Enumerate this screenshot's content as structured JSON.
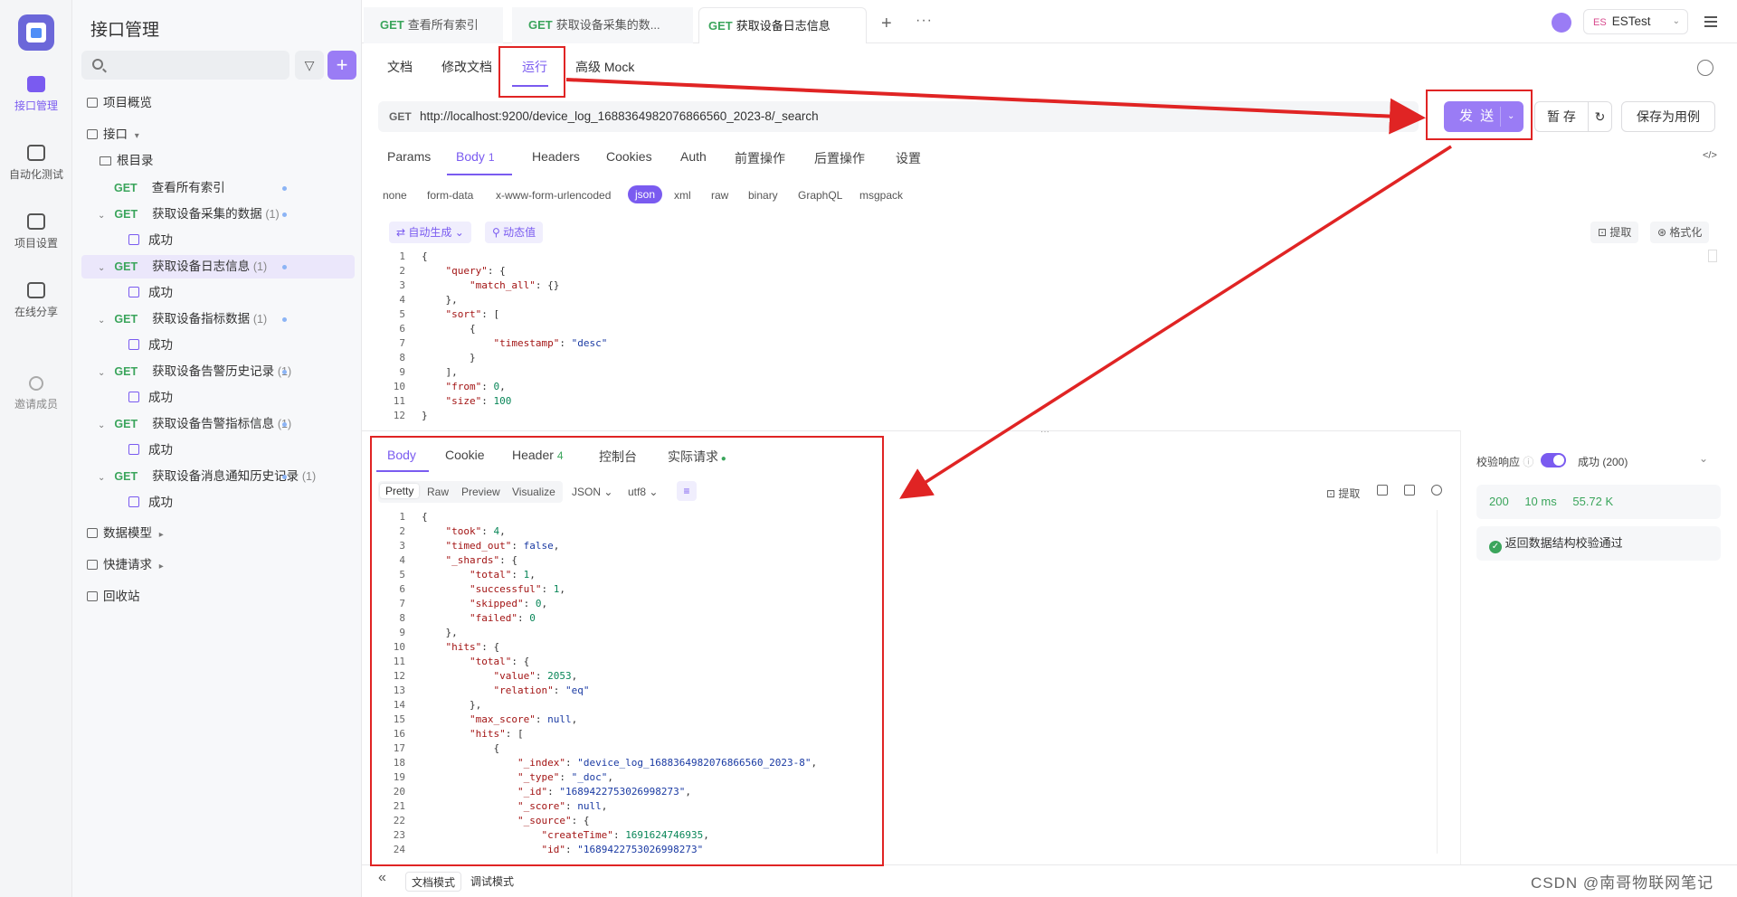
{
  "rail": {
    "items": [
      {
        "label": "接口管理"
      },
      {
        "label": "自动化测试"
      },
      {
        "label": "项目设置"
      },
      {
        "label": "在线分享"
      },
      {
        "label": "邀请成员"
      }
    ]
  },
  "tree": {
    "title": "接口管理",
    "overview": "项目概览",
    "interfaces": "接口",
    "root": "根目录",
    "items": [
      {
        "method": "GET",
        "name": "查看所有索引",
        "count": ""
      },
      {
        "method": "GET",
        "name": "获取设备采集的数据",
        "count": "(1)"
      },
      {
        "method": "GET",
        "name": "获取设备日志信息",
        "count": "(1)"
      },
      {
        "method": "GET",
        "name": "获取设备指标数据",
        "count": "(1)"
      },
      {
        "method": "GET",
        "name": "获取设备告警历史记录",
        "count": "(1)"
      },
      {
        "method": "GET",
        "name": "获取设备告警指标信息",
        "count": "(1)"
      },
      {
        "method": "GET",
        "name": "获取设备消息通知历史记录",
        "count": "(1)"
      }
    ],
    "success": "成功",
    "data_model": "数据模型",
    "quick_request": "快捷请求",
    "recycle": "回收站"
  },
  "tabs": [
    {
      "method": "GET",
      "label": "查看所有索引"
    },
    {
      "method": "GET",
      "label": "获取设备采集的数..."
    },
    {
      "method": "GET",
      "label": "获取设备日志信息"
    }
  ],
  "env": {
    "tag": "ES",
    "name": "ESTest"
  },
  "subtabs": {
    "doc": "文档",
    "edit": "修改文档",
    "run": "运行",
    "mock": "高级 Mock"
  },
  "request": {
    "method": "GET",
    "url": "http://localhost:9200/device_log_1688364982076866560_2023-8/_search",
    "send": "发 送",
    "save": "暂 存",
    "save_case": "保存为用例"
  },
  "req_tabs": {
    "params": "Params",
    "body": "Body",
    "body_count": "1",
    "headers": "Headers",
    "cookies": "Cookies",
    "auth": "Auth",
    "pre": "前置操作",
    "post": "后置操作",
    "settings": "设置"
  },
  "body_types": [
    "none",
    "form-data",
    "x-www-form-urlencoded",
    "json",
    "xml",
    "raw",
    "binary",
    "GraphQL",
    "msgpack"
  ],
  "body_tools": {
    "auto": "自动生成",
    "dynamic": "动态值",
    "extract": "提取",
    "format": "格式化"
  },
  "resp_tabs": {
    "body": "Body",
    "cookie": "Cookie",
    "header": "Header",
    "header_count": "4",
    "console": "控制台",
    "actual": "实际请求"
  },
  "resp_formats": {
    "pretty": "Pretty",
    "raw": "Raw",
    "preview": "Preview",
    "visualize": "Visualize",
    "json": "JSON",
    "encoding": "utf8",
    "extract": "提取"
  },
  "validation": {
    "label": "校验响应",
    "result": "成功 (200)",
    "status": "200",
    "time": "10 ms",
    "size": "55.72 K",
    "pass_msg": "返回数据结构校验通过"
  },
  "bottom": {
    "doc_mode": "文档模式",
    "debug_mode": "调试模式",
    "watermark": "CSDN @南哥物联网笔记"
  }
}
